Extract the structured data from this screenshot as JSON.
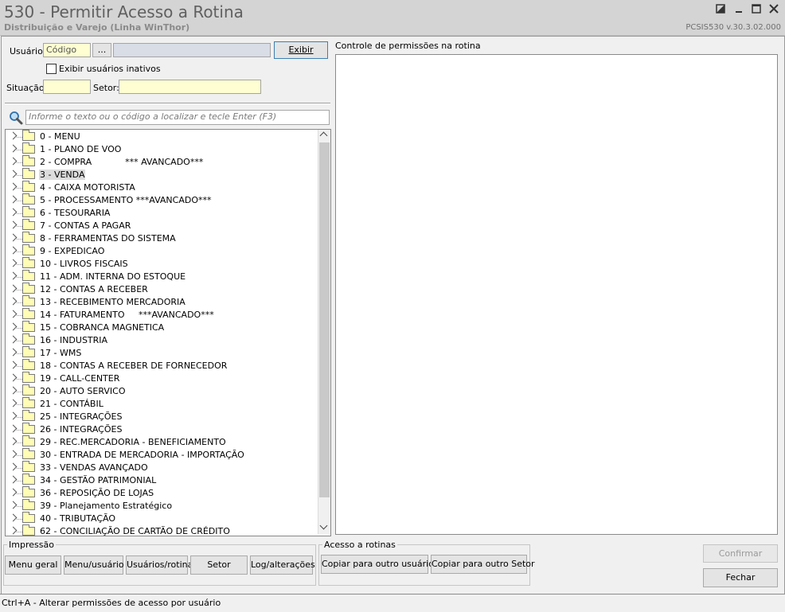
{
  "window": {
    "title": "530 - Permitir Acesso a Rotina",
    "subtitle": "Distribuição e Varejo (Linha WinThor)",
    "version": "PCSIS530  v.30.3.02.000"
  },
  "filters": {
    "usuario_label": "Usuário:",
    "codigo_placeholder": "Código",
    "lookup_label": "...",
    "exibir_label": "Exibir",
    "inativos_label": "Exibir usuários inativos",
    "situacao_label": "Situação:",
    "setor_label": "Setor:"
  },
  "search": {
    "placeholder": "Informe o texto ou o código a localizar e tecle Enter (F3)"
  },
  "tree": {
    "selected_index": 3,
    "items": [
      "0 - MENU",
      "1 - PLANO DE VOO",
      "2 - COMPRA            *** AVANCADO***",
      "3 - VENDA",
      "4 - CAIXA MOTORISTA",
      "5 - PROCESSAMENTO ***AVANCADO***",
      "6 - TESOURARIA",
      "7 - CONTAS A PAGAR",
      "8 - FERRAMENTAS DO SISTEMA",
      "9 - EXPEDICAO",
      "10 - LIVROS FISCAIS",
      "11 - ADM. INTERNA DO ESTOQUE",
      "12 - CONTAS A RECEBER",
      "13 - RECEBIMENTO MERCADORIA",
      "14 - FATURAMENTO     ***AVANCADO***",
      "15 - COBRANCA MAGNETICA",
      "16 - INDUSTRIA",
      "17 - WMS",
      "18 - CONTAS A RECEBER DE FORNECEDOR",
      "19 - CALL-CENTER",
      "20 - AUTO SERVICO",
      "21 - CONTÁBIL",
      "25 - INTEGRAÇÕES",
      "26 - INTEGRAÇÕES",
      "29 - REC.MERCADORIA - BENEFICIAMENTO",
      "30 - ENTRADA DE MERCADORIA - IMPORTAÇÃO",
      "33 - VENDAS AVANÇADO",
      "34 - GESTÃO PATRIMONIAL",
      "36 - REPOSIÇÃO DE LOJAS",
      "39 - Planejamento Estratégico",
      "40 - TRIBUTAÇÃO",
      "62 - CONCILIAÇÃO DE CARTÃO DE CRÉDITO"
    ]
  },
  "permissions": {
    "label": "Controle de permissões na rotina"
  },
  "impressao": {
    "legend": "Impressão",
    "menu_geral": "Menu geral",
    "menu_usuario": "Menu/usuário",
    "usuarios_rotina": "Usuários/rotina",
    "setor": "Setor",
    "log_alteracoes": "Log/alterações"
  },
  "acesso": {
    "legend": "Acesso a rotinas",
    "copiar_usuario": "Copiar para outro usuário",
    "copiar_setor": "Copiar para outro Setor"
  },
  "actions": {
    "confirmar": "Confirmar",
    "fechar": "Fechar"
  },
  "statusbar": {
    "text": "Ctrl+A - Alterar permissões de acesso por usuário"
  }
}
